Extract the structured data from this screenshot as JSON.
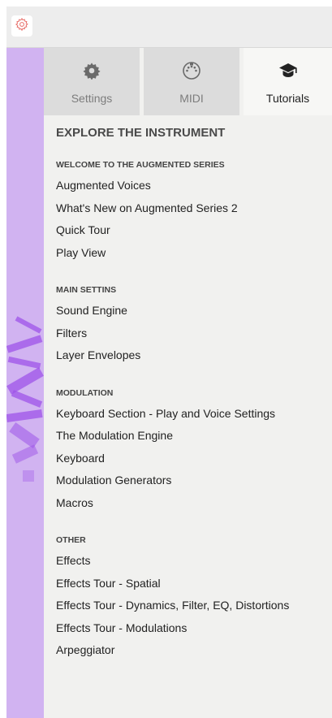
{
  "toolbar": {
    "settings_icon": "gear-icon"
  },
  "colors": {
    "accent": "#e8716c",
    "art_bg": "#d1b3f1",
    "art_shape": "#9d53e8",
    "panel_bg": "#f1f1ef"
  },
  "tabs": [
    {
      "label": "Settings",
      "icon": "gear-icon",
      "active": false
    },
    {
      "label": "MIDI",
      "icon": "midi-connector-icon",
      "active": false
    },
    {
      "label": "Tutorials",
      "icon": "graduation-cap-icon",
      "active": true
    }
  ],
  "panel": {
    "title": "EXPLORE THE INSTRUMENT",
    "sections": [
      {
        "heading": "WELCOME TO THE AUGMENTED SERIES",
        "items": [
          "Augmented Voices",
          "What's New on Augmented Series 2",
          "Quick Tour",
          "Play View"
        ]
      },
      {
        "heading": "MAIN SETTINS",
        "items": [
          "Sound Engine",
          "Filters",
          "Layer Envelopes"
        ]
      },
      {
        "heading": "MODULATION",
        "items": [
          "Keyboard Section - Play and Voice Settings",
          "The Modulation Engine",
          "Keyboard",
          "Modulation Generators",
          "Macros"
        ]
      },
      {
        "heading": "OTHER",
        "items": [
          "Effects",
          "Effects Tour - Spatial",
          "Effects Tour - Dynamics, Filter, EQ, Distortions",
          "Effects Tour - Modulations",
          "Arpeggiator"
        ]
      }
    ]
  }
}
